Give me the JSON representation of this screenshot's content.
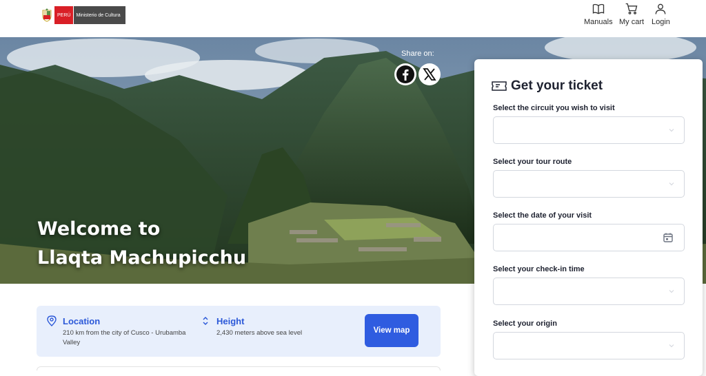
{
  "header": {
    "logo": {
      "country": "PERÚ",
      "ministry": "Ministerio de Cultura"
    },
    "nav": [
      {
        "label": "Manuals",
        "icon": "book-icon"
      },
      {
        "label": "My cart",
        "icon": "cart-icon"
      },
      {
        "label": "Login",
        "icon": "user-icon"
      }
    ]
  },
  "hero": {
    "share_label": "Share on:",
    "share": [
      {
        "network": "Facebook",
        "icon": "facebook-icon"
      },
      {
        "network": "X",
        "icon": "x-icon"
      }
    ],
    "title_line1": "Welcome to",
    "title_line2": "Llaqta Machupicchu"
  },
  "info": {
    "location": {
      "title": "Location",
      "desc": "210 km from the city of Cusco - Urubamba Valley"
    },
    "height": {
      "title": "Height",
      "desc": "2,430 meters above sea level"
    },
    "view_map": "View map"
  },
  "ticket": {
    "title": "Get your ticket",
    "fields": [
      {
        "label": "Select the circuit you wish to visit",
        "value": ""
      },
      {
        "label": "Select your tour route",
        "value": ""
      },
      {
        "label": "Select the date of your visit",
        "value": ""
      },
      {
        "label": "Select your check-in time",
        "value": ""
      },
      {
        "label": "Select your origin",
        "value": ""
      }
    ]
  },
  "colors": {
    "accent": "#2f5ce0",
    "info_bg": "#e8effc",
    "brand_red": "#d91f26"
  }
}
